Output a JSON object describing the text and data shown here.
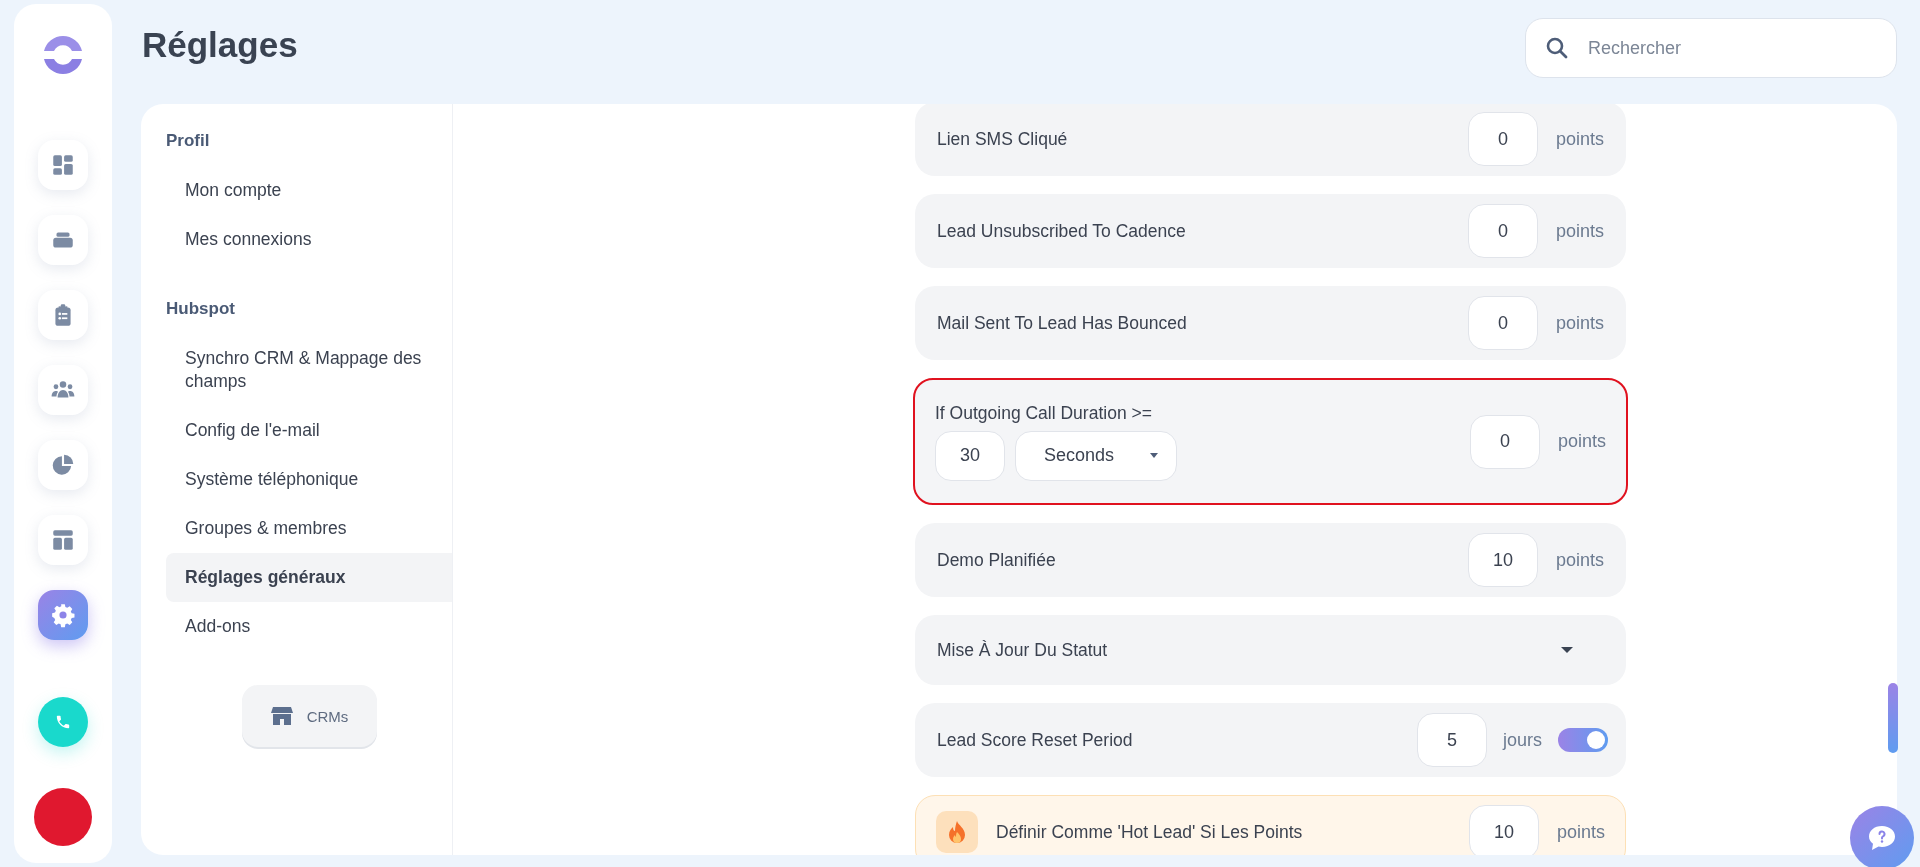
{
  "rail": {
    "items": [
      {
        "kind": "dashboard",
        "selected": false
      },
      {
        "kind": "inbox",
        "selected": false
      },
      {
        "kind": "clipboard",
        "selected": false
      },
      {
        "kind": "team",
        "selected": false
      },
      {
        "kind": "pie",
        "selected": false
      },
      {
        "kind": "layout",
        "selected": false
      },
      {
        "kind": "settings",
        "selected": true
      }
    ]
  },
  "header": {
    "title": "Réglages",
    "search": {
      "placeholder": "Rechercher"
    }
  },
  "nav": {
    "sections": [
      {
        "heading": "Profil",
        "items": [
          {
            "label": "Mon compte",
            "selected": false
          },
          {
            "label": "Mes connexions",
            "selected": false
          }
        ]
      },
      {
        "heading": "Hubspot",
        "items": [
          {
            "label": "Synchro CRM & Mappage des champs",
            "selected": false
          },
          {
            "label": "Config de l'e-mail",
            "selected": false
          },
          {
            "label": "Système téléphonique",
            "selected": false
          },
          {
            "label": "Groupes & membres",
            "selected": false
          },
          {
            "label": "Réglages généraux",
            "selected": true
          },
          {
            "label": "Add-ons",
            "selected": false
          }
        ]
      }
    ],
    "crm_button": "CRMs"
  },
  "rules": [
    {
      "kind": "points",
      "label": "Lien SMS Cliqué",
      "value": "0",
      "unit": "points",
      "highlighted": false
    },
    {
      "kind": "points",
      "label": "Lead Unsubscribed To Cadence",
      "value": "0",
      "unit": "points",
      "highlighted": false
    },
    {
      "kind": "points",
      "label": "Mail Sent To Lead Has Bounced",
      "value": "0",
      "unit": "points",
      "highlighted": false
    },
    {
      "kind": "duration",
      "label": "If Outgoing Call Duration >=",
      "duration": "30",
      "duration_unit": "Seconds",
      "value": "0",
      "unit": "points",
      "highlighted": true
    },
    {
      "kind": "points",
      "label": "Demo Planifiée",
      "value": "10",
      "unit": "points",
      "highlighted": false
    },
    {
      "kind": "dropdown",
      "label": "Mise À Jour Du Statut",
      "highlighted": false
    },
    {
      "kind": "period",
      "label": "Lead Score Reset Period",
      "value": "5",
      "unit": "jours",
      "on": true,
      "highlighted": false
    },
    {
      "kind": "hot",
      "label": "Définir Comme 'Hot Lead' Si Les Points",
      "value": "10",
      "unit": "points",
      "highlighted": false
    }
  ]
}
